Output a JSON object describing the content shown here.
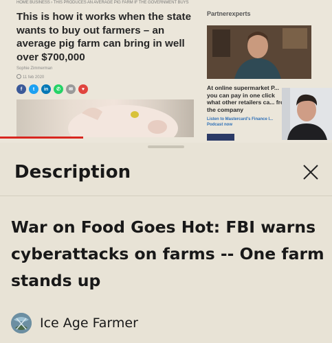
{
  "article": {
    "breadcrumb": "HOME BUSINESS › THIS PRODUCES AN AVERAGE PIG FARM IF THE GOVERNMENT BUYS",
    "headline": "This is how it works when the state wants to buy out farmers – an average pig farm can bring in well over $700,000",
    "author": "Sophie Zimmerman",
    "date": "11 feb 2020",
    "share_buttons": [
      {
        "label": "f",
        "icon": "facebook-icon",
        "color": "#3b5998"
      },
      {
        "label": "t",
        "icon": "twitter-icon",
        "color": "#1da1f2"
      },
      {
        "label": "in",
        "icon": "linkedin-icon",
        "color": "#0077b5"
      },
      {
        "label": "✆",
        "icon": "whatsapp-icon",
        "color": "#25d366"
      },
      {
        "label": "✉",
        "icon": "mail-icon",
        "color": "#9a9a9a"
      },
      {
        "label": "♥",
        "icon": "pocket-icon",
        "color": "#e0453f"
      }
    ]
  },
  "sidebar": {
    "heading": "Partnerexperts",
    "promo_text": "At online supermarket P... you can pay in one click what other retailers ca... from the company",
    "promo_link": "Listen to Mastercard's Finance I... Podcast now"
  },
  "player": {
    "progress_fraction": 0.25
  },
  "sheet": {
    "title": "Description",
    "video_title": "War on Food Goes Hot: FBI warns cyberattacks on farms -- One farm stands up",
    "channel_name": "Ice Age Farmer"
  },
  "colors": {
    "accent": "#d8261f",
    "sheet_bg": "#e8e3d6",
    "text": "#181818"
  }
}
